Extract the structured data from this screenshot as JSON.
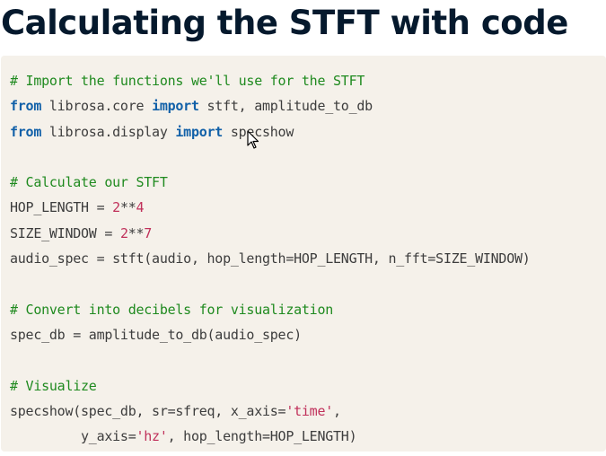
{
  "page": {
    "title": "Calculating the STFT with code"
  },
  "code": {
    "lines": [
      [
        {
          "t": "# Import the functions we'll use for the STFT",
          "k": "comment"
        }
      ],
      [
        {
          "t": "from",
          "k": "keyword"
        },
        {
          "t": " librosa.core ",
          "k": "plain"
        },
        {
          "t": "import",
          "k": "keyword"
        },
        {
          "t": " stft, amplitude_to_db",
          "k": "plain"
        }
      ],
      [
        {
          "t": "from",
          "k": "keyword"
        },
        {
          "t": " librosa.display ",
          "k": "plain"
        },
        {
          "t": "import",
          "k": "keyword"
        },
        {
          "t": " specshow",
          "k": "plain"
        }
      ],
      [],
      [
        {
          "t": "# Calculate our STFT",
          "k": "comment"
        }
      ],
      [
        {
          "t": "HOP_LENGTH = ",
          "k": "plain"
        },
        {
          "t": "2",
          "k": "number"
        },
        {
          "t": "**",
          "k": "plain"
        },
        {
          "t": "4",
          "k": "number"
        }
      ],
      [
        {
          "t": "SIZE_WINDOW = ",
          "k": "plain"
        },
        {
          "t": "2",
          "k": "number"
        },
        {
          "t": "**",
          "k": "plain"
        },
        {
          "t": "7",
          "k": "number"
        }
      ],
      [
        {
          "t": "audio_spec = stft(audio, hop_length=HOP_LENGTH, n_fft=SIZE_WINDOW)",
          "k": "plain"
        }
      ],
      [],
      [
        {
          "t": "# Convert into decibels for visualization",
          "k": "comment"
        }
      ],
      [
        {
          "t": "spec_db = amplitude_to_db(audio_spec)",
          "k": "plain"
        }
      ],
      [],
      [
        {
          "t": "# Visualize",
          "k": "comment"
        }
      ],
      [
        {
          "t": "specshow(spec_db, sr=sfreq, x_axis=",
          "k": "plain"
        },
        {
          "t": "'time'",
          "k": "string"
        },
        {
          "t": ",",
          "k": "plain"
        }
      ],
      [
        {
          "t": "         y_axis=",
          "k": "plain"
        },
        {
          "t": "'hz'",
          "k": "string"
        },
        {
          "t": ", hop_length=HOP_LENGTH)",
          "k": "plain"
        }
      ]
    ]
  },
  "colors": {
    "title": "#05192d",
    "code_background": "#f5f1ea",
    "comment": "#1f8a1f",
    "keyword": "#1160a8",
    "literal": "#c0305a",
    "plain": "#3d3d3d"
  },
  "icons": {
    "cursor": "mouse-pointer-icon"
  }
}
